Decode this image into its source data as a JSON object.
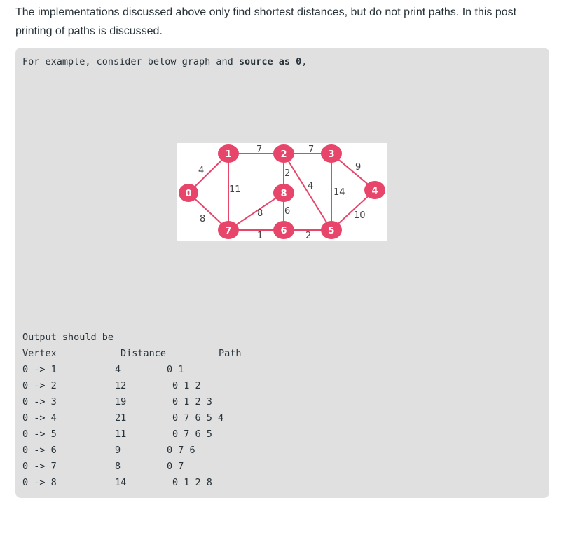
{
  "intro": {
    "text": "The implementations discussed above only find shortest distances, but do not print paths. In this post printing of paths is discussed."
  },
  "example": {
    "prefix": "For example, consider below graph and ",
    "bold": "source as 0",
    "suffix": ","
  },
  "graph": {
    "node_color": "#e8456b",
    "edge_color": "#e8456b",
    "nodes": [
      "0",
      "1",
      "2",
      "3",
      "4",
      "5",
      "6",
      "7",
      "8"
    ],
    "edge_labels": [
      "4",
      "8",
      "7",
      "11",
      "2",
      "9",
      "10",
      "14",
      "4",
      "7",
      "6",
      "2",
      "1",
      "8"
    ]
  },
  "output": {
    "heading": "Output should be",
    "col_vertex": "Vertex",
    "col_distance": "Distance",
    "col_path": "Path",
    "rows": [
      {
        "vertex": "0 -> 1",
        "distance": "4",
        "path": "0 1"
      },
      {
        "vertex": "0 -> 2",
        "distance": "12",
        "path": "0 1 2"
      },
      {
        "vertex": "0 -> 3",
        "distance": "19",
        "path": "0 1 2 3"
      },
      {
        "vertex": "0 -> 4",
        "distance": "21",
        "path": "0 7 6 5 4"
      },
      {
        "vertex": "0 -> 5",
        "distance": "11",
        "path": "0 7 6 5"
      },
      {
        "vertex": "0 -> 6",
        "distance": "9",
        "path": "0 7 6"
      },
      {
        "vertex": "0 -> 7",
        "distance": "8",
        "path": "0 7"
      },
      {
        "vertex": "0 -> 8",
        "distance": "14",
        "path": "0 1 2 8"
      }
    ]
  }
}
